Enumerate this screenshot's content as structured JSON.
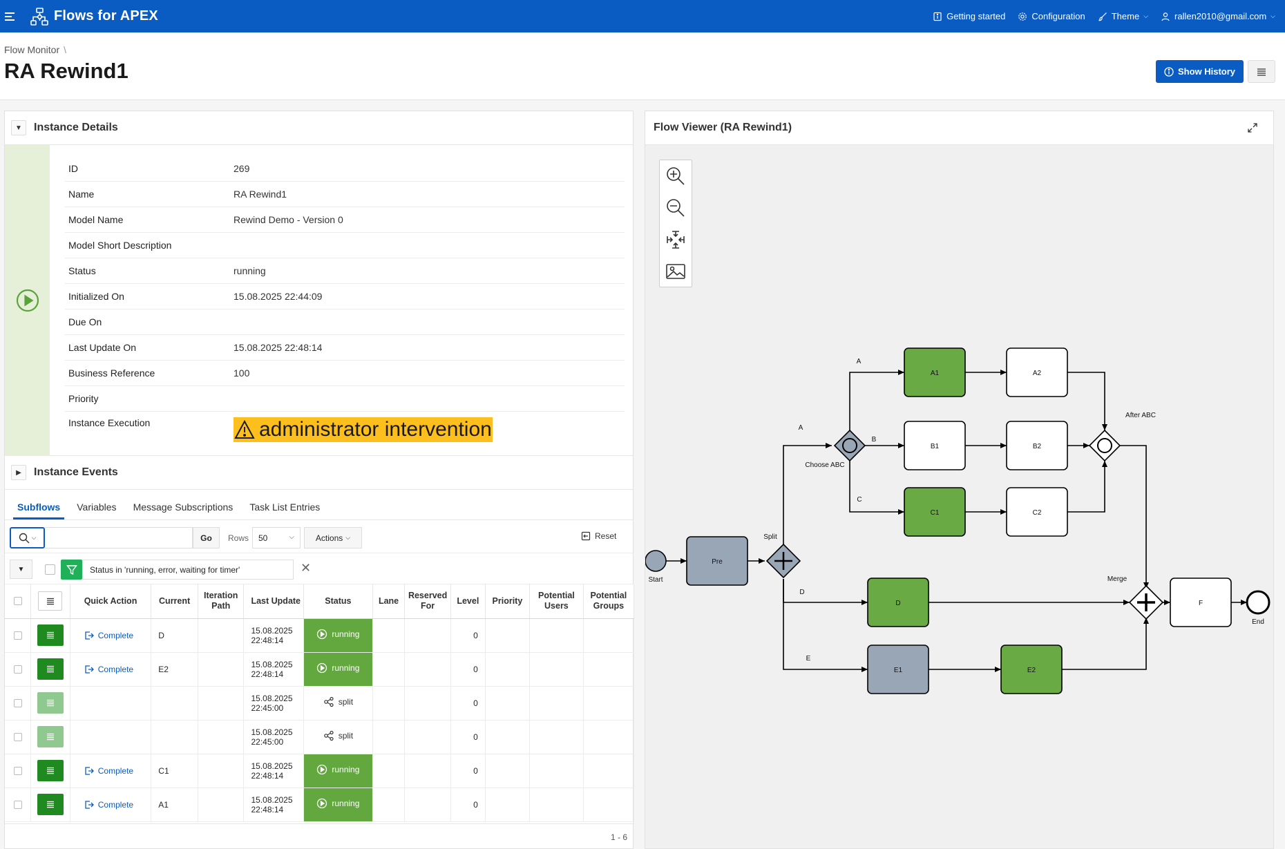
{
  "app": {
    "title": "Flows for APEX",
    "nav": {
      "getting_started": "Getting started",
      "configuration": "Configuration",
      "theme": "Theme",
      "user": "rallen2010@gmail.com"
    }
  },
  "header": {
    "breadcrumb": "Flow Monitor",
    "title": "RA Rewind1",
    "show_history": "Show History"
  },
  "details": {
    "region_title": "Instance Details",
    "rows": [
      {
        "label": "ID",
        "value": "269"
      },
      {
        "label": "Name",
        "value": "RA Rewind1"
      },
      {
        "label": "Model Name",
        "value": "Rewind Demo - Version 0"
      },
      {
        "label": "Model Short Description",
        "value": ""
      },
      {
        "label": "Status",
        "value": "running"
      },
      {
        "label": "Initialized On",
        "value": "15.08.2025 22:44:09"
      },
      {
        "label": "Due On",
        "value": ""
      },
      {
        "label": "Last Update On",
        "value": "15.08.2025 22:48:14"
      },
      {
        "label": "Business Reference",
        "value": "100"
      },
      {
        "label": "Priority",
        "value": ""
      },
      {
        "label": "Instance Execution",
        "value": "administrator intervention"
      }
    ]
  },
  "events": {
    "region_title": "Instance Events"
  },
  "tabs": [
    "Subflows",
    "Variables",
    "Message Subscriptions",
    "Task List Entries"
  ],
  "toolbar": {
    "go": "Go",
    "rows_label": "Rows",
    "rows_value": "50",
    "actions": "Actions",
    "reset": "Reset"
  },
  "filter": {
    "text": "Status in 'running, error, waiting for timer'"
  },
  "grid": {
    "columns": [
      "Quick Action",
      "Current",
      "Iteration Path",
      "Last Update",
      "Status",
      "Lane",
      "Reserved For",
      "Level",
      "Priority",
      "Potential Users",
      "Potential Groups"
    ],
    "rows": [
      {
        "action": "Complete",
        "current": "D",
        "iteration": "",
        "date": "15.08.2025",
        "time": "22:48:14",
        "status": "running",
        "level": "0",
        "menu": "dark"
      },
      {
        "action": "Complete",
        "current": "E2",
        "iteration": "",
        "date": "15.08.2025",
        "time": "22:48:14",
        "status": "running",
        "level": "0",
        "menu": "dark"
      },
      {
        "action": "",
        "current": "",
        "iteration": "",
        "date": "15.08.2025",
        "time": "22:45:00",
        "status": "split",
        "level": "0",
        "menu": "light"
      },
      {
        "action": "",
        "current": "",
        "iteration": "",
        "date": "15.08.2025",
        "time": "22:45:00",
        "status": "split",
        "level": "0",
        "menu": "light"
      },
      {
        "action": "Complete",
        "current": "C1",
        "iteration": "",
        "date": "15.08.2025",
        "time": "22:48:14",
        "status": "running",
        "level": "0",
        "menu": "dark"
      },
      {
        "action": "Complete",
        "current": "A1",
        "iteration": "",
        "date": "15.08.2025",
        "time": "22:48:14",
        "status": "running",
        "level": "0",
        "menu": "dark"
      }
    ],
    "pagination": "1 - 6"
  },
  "viewer": {
    "title": "Flow Viewer (RA Rewind1)",
    "nodes": {
      "start": "Start",
      "pre": "Pre",
      "split": "Split",
      "choose": "Choose ABC",
      "a1": "A1",
      "a2": "A2",
      "b1": "B1",
      "b2": "B2",
      "c1": "C1",
      "c2": "C2",
      "after": "After ABC",
      "d": "D",
      "e1": "E1",
      "e2": "E2",
      "merge": "Merge",
      "f": "F",
      "end": "End"
    },
    "edges": {
      "a_outer": "A",
      "a_inner": "A",
      "b": "B",
      "c": "C",
      "d": "D",
      "e": "E"
    },
    "colors": {
      "completed": "#6aaa45",
      "current": "#99a6b6",
      "neutral": "#ffffff"
    }
  }
}
